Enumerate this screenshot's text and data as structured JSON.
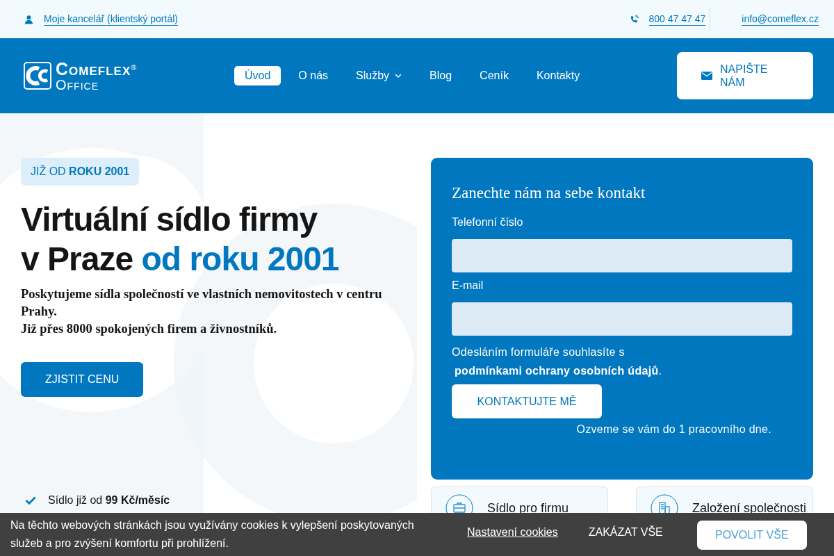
{
  "topbar": {
    "portal_link": "Moje kancelář (klientský portál)",
    "phone": "800 47 47 47",
    "email": "info@comeflex.cz"
  },
  "header": {
    "logo": {
      "name": "OMEFLEX",
      "name_initial": "C",
      "sub": "FFICE",
      "sub_initial": "O",
      "mark": "®"
    },
    "nav": [
      {
        "label": "Úvod",
        "selected": true,
        "dropdown": false
      },
      {
        "label": "O nás",
        "selected": false,
        "dropdown": false
      },
      {
        "label": "Služby",
        "selected": false,
        "dropdown": true
      },
      {
        "label": "Blog",
        "selected": false,
        "dropdown": false
      },
      {
        "label": "Ceník",
        "selected": false,
        "dropdown": false
      },
      {
        "label": "Kontakty",
        "selected": false,
        "dropdown": false
      }
    ],
    "cta": "NAPIŠTE NÁM"
  },
  "hero": {
    "badge": "JIŽ OD **ROKU 2001**",
    "title_line1": "Virtuální sídlo firmy",
    "title_line2": "v Praze",
    "title_highlight": "od roku 2001",
    "lead": "Poskytujeme sídla společností ve vlastních nemovitostech v centru Prahy.",
    "lead2": "Již přes 8000 spokojených firem a živnostníků.",
    "button": "ZJISTIT CENU",
    "features": [
      "Sídlo již od **99 Kč/měsíc**"
    ]
  },
  "form": {
    "title": "Zanechte nám na sebe kontakt",
    "fields": [
      {
        "label": "Telefonní číslo"
      },
      {
        "label": "E-mail"
      }
    ],
    "consent": "Odesláním formuláře souhlasíte s",
    "consent_link": "podmínkami ochrany osobních údajů",
    "consent_end": ".",
    "submit": "KONTAKTUJTE MĚ",
    "note": "Ozveme se vám do 1 pracovního dne."
  },
  "services": [
    {
      "label": "Sídlo pro firmu",
      "kind": "briefcase"
    },
    {
      "label": "Založení společnosti",
      "kind": "building"
    }
  ],
  "cookie_bar": {
    "text": "Na těchto webových stránkách jsou využívány cookies k vylepšení poskytovaných služeb a pro zvýšení komfortu při prohlížení.",
    "settings": "Nastavení cookies",
    "reject": "ZAKÁZAT VŠE",
    "accept": "POVOLIT VŠE"
  }
}
